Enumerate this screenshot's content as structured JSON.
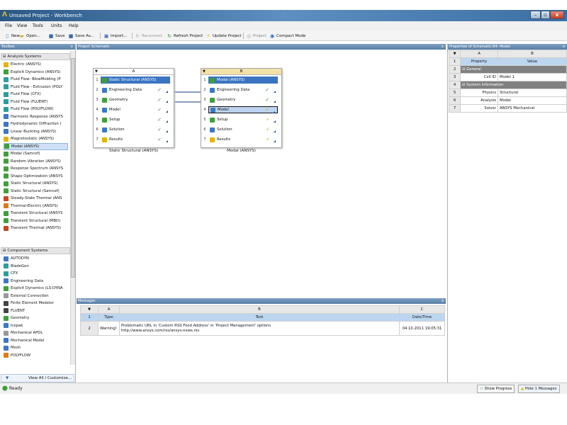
{
  "window": {
    "title": "Unsaved Project - Workbench",
    "min_glyph": "–",
    "max_glyph": "▫",
    "close_glyph": "x"
  },
  "menu": [
    "File",
    "View",
    "Tools",
    "Units",
    "Help"
  ],
  "toolbar": {
    "new": "New",
    "open": "Open...",
    "save": "Save",
    "save_as": "Save As...",
    "import": "Import...",
    "reconnect": "Reconnect",
    "refresh": "Refresh Project",
    "update": "Update Project",
    "project": "Project",
    "compact": "Compact Mode"
  },
  "toolbox": {
    "title": "Toolbox",
    "close": "x",
    "analysis_header": "Analysis Systems",
    "analysis_items": [
      {
        "label": "Electric (ANSYS)",
        "icon": "y"
      },
      {
        "label": "Explicit Dynamics (ANSYS)",
        "icon": "g"
      },
      {
        "label": "Fluid Flow- BlowMolding (P",
        "icon": "t"
      },
      {
        "label": "Fluid Flow - Extrusion (POLY",
        "icon": "t"
      },
      {
        "label": "Fluid Flow (CFX)",
        "icon": "t"
      },
      {
        "label": "Fluid Flow (FLUENT)",
        "icon": "t"
      },
      {
        "label": "Fluid Flow (POLYFLOW)",
        "icon": "t"
      },
      {
        "label": "Harmonic Response (ANSYS",
        "icon": "b"
      },
      {
        "label": "Hydrodynamic Diffraction (",
        "icon": "b"
      },
      {
        "label": "Linear Buckling (ANSYS)",
        "icon": "b"
      },
      {
        "label": "Magnetostatic (ANSYS)",
        "icon": "y"
      },
      {
        "label": "Modal (ANSYS)",
        "icon": "g"
      },
      {
        "label": "Modal (Samcef)",
        "icon": "g"
      },
      {
        "label": "Random Vibration (ANSYS)",
        "icon": "g"
      },
      {
        "label": "Response Spectrum (ANSYS",
        "icon": "g"
      },
      {
        "label": "Shape Optimization (ANSYS",
        "icon": "g"
      },
      {
        "label": "Static Structural (ANSYS)",
        "icon": "g"
      },
      {
        "label": "Static Structural (Samcef)",
        "icon": "g"
      },
      {
        "label": "Steady-State Thermal (ANS",
        "icon": "r"
      },
      {
        "label": "Thermal-Electric (ANSYS)",
        "icon": "o"
      },
      {
        "label": "Transient Structural (ANSYS",
        "icon": "g"
      },
      {
        "label": "Transient Structural (MBD)",
        "icon": "g"
      },
      {
        "label": "Transient Thermal (ANSYS)",
        "icon": "r"
      }
    ],
    "component_header": "Component Systems",
    "component_items": [
      {
        "label": "AUTODYN",
        "icon": "b"
      },
      {
        "label": "BladeGen",
        "icon": "t"
      },
      {
        "label": "CFX",
        "icon": "t"
      },
      {
        "label": "Engineering Data",
        "icon": "b"
      },
      {
        "label": "Explicit Dynamics (LS-DYNA",
        "icon": "g"
      },
      {
        "label": "External Connection",
        "icon": "gr"
      },
      {
        "label": "Finite Element Modeler",
        "icon": "k"
      },
      {
        "label": "FLUENT",
        "icon": "k"
      },
      {
        "label": "Geometry",
        "icon": "g"
      },
      {
        "label": "Icepak",
        "icon": "b"
      },
      {
        "label": "Mechanical APDL",
        "icon": "gr"
      },
      {
        "label": "Mechanical Model",
        "icon": "b"
      },
      {
        "label": "Mesh",
        "icon": "b"
      },
      {
        "label": "POLYFLOW",
        "icon": "o"
      }
    ],
    "view_all": "View All / Customize..."
  },
  "schematic": {
    "title": "Project Schematic",
    "close": "x",
    "system_a": {
      "col": "A",
      "rows": [
        {
          "n": "1",
          "label": "Static Structural (ANSYS)",
          "icon": "g",
          "status": ""
        },
        {
          "n": "2",
          "label": "Engineering Data",
          "icon": "b",
          "status": "✓"
        },
        {
          "n": "3",
          "label": "Geometry",
          "icon": "g",
          "status": "✓"
        },
        {
          "n": "4",
          "label": "Model",
          "icon": "b",
          "status": "✓"
        },
        {
          "n": "5",
          "label": "Setup",
          "icon": "g",
          "status": "✓"
        },
        {
          "n": "6",
          "label": "Solution",
          "icon": "b",
          "status": "✓"
        },
        {
          "n": "7",
          "label": "Results",
          "icon": "y",
          "status": "✓"
        }
      ],
      "caption": "Static Structural (ANSYS)"
    },
    "system_b": {
      "col": "B",
      "rows": [
        {
          "n": "1",
          "label": "Modal (ANSYS)",
          "icon": "g",
          "status": ""
        },
        {
          "n": "2",
          "label": "Engineering Data",
          "icon": "b",
          "status": "✓"
        },
        {
          "n": "3",
          "label": "Geometry",
          "icon": "g",
          "status": "✓"
        },
        {
          "n": "4",
          "label": "Model",
          "icon": "b",
          "status": "⚡"
        },
        {
          "n": "5",
          "label": "Setup",
          "icon": "g",
          "status": "⚡"
        },
        {
          "n": "6",
          "label": "Solution",
          "icon": "b",
          "status": "⚡"
        },
        {
          "n": "7",
          "label": "Results",
          "icon": "y",
          "status": "⚡"
        }
      ],
      "caption": "Modal (ANSYS)"
    }
  },
  "properties": {
    "title": "Properties of Schematic B4: Model",
    "close": "x",
    "colA": "A",
    "colB": "B",
    "rows": [
      {
        "n": "1",
        "a": "Property",
        "b": "Value",
        "kind": "header"
      },
      {
        "n": "2",
        "a": "General",
        "b": "",
        "kind": "group"
      },
      {
        "n": "3",
        "a": "Cell ID",
        "b": "Model 1",
        "kind": "row"
      },
      {
        "n": "4",
        "a": "System Information",
        "b": "",
        "kind": "group"
      },
      {
        "n": "5",
        "a": "Physics",
        "b": "Structural",
        "kind": "row"
      },
      {
        "n": "6",
        "a": "Analysis",
        "b": "Modal",
        "kind": "row"
      },
      {
        "n": "7",
        "a": "Solver",
        "b": "ANSYS Mechanical",
        "kind": "row"
      }
    ]
  },
  "messages": {
    "title": "Messages",
    "close": "x",
    "colA": "A",
    "colB": "B",
    "colC": "C",
    "h_type": "Type",
    "h_text": "Text",
    "h_date": "Date/Time",
    "row_n": "2",
    "type": "Warning!",
    "text1": "Problematic URL in 'Custom RSS Feed Address' in 'Project Management' options",
    "text2": "http://www.ansys.com/rss/ansys-news.rss",
    "date": "04.10.2011 19:05:31"
  },
  "status": {
    "ready": "Ready",
    "show_progress": "Show Progress",
    "hide_messages": "Hide 1 Messages"
  },
  "colors": {
    "accent": "#3b75c2",
    "title_bar": "#2a5886",
    "panel_header": "#5a7fa6",
    "up_to_date": "#2f8a2f",
    "refresh_required": "#e0b000"
  }
}
